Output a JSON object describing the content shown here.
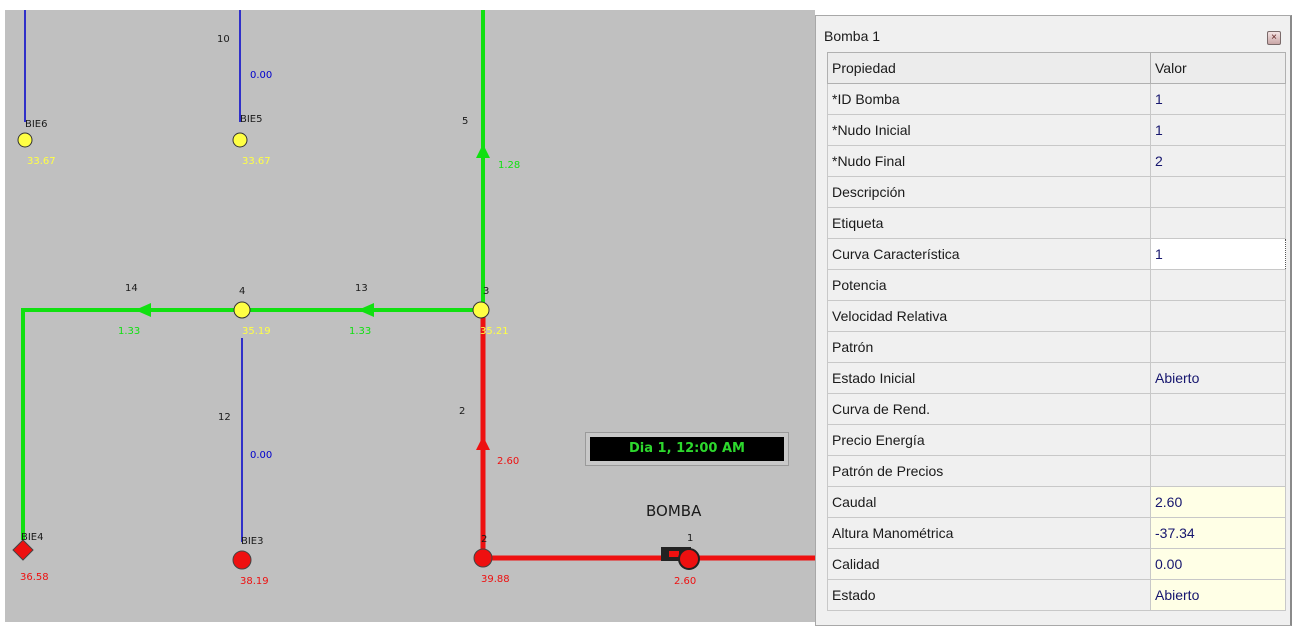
{
  "network": {
    "nodes": [
      {
        "id": "10",
        "value": ""
      },
      {
        "id": "BIE6",
        "value": "33.67"
      },
      {
        "id": "BIE5",
        "value": "33.67"
      },
      {
        "id": "4",
        "value": "35.19"
      },
      {
        "id": "3",
        "value": "35.21"
      },
      {
        "id": "BIE4",
        "value": "36.58"
      },
      {
        "id": "BIE3",
        "value": "38.19"
      },
      {
        "id": "2",
        "value": "39.88"
      }
    ],
    "links": [
      {
        "id": "5",
        "flow": "1.28"
      },
      {
        "id": "14",
        "flow": "1.33"
      },
      {
        "id": "13",
        "flow": "1.33"
      },
      {
        "id": "12",
        "flow": "0.00"
      },
      {
        "id": "2",
        "flow": "2.60"
      },
      {
        "id": "1",
        "flow": "2.60"
      }
    ],
    "link_10_flow": "0.00",
    "pump_label": "BOMBA",
    "colors": {
      "green": "#10e010",
      "red": "#ee1010",
      "blue": "#0000cc",
      "yellow": "#ffff44",
      "background": "#c0c0c0"
    }
  },
  "clock": "Dia 1, 12:00 AM",
  "panel": {
    "title": "Bomba 1",
    "close_icon": "close-icon",
    "columns": [
      "Propiedad",
      "Valor"
    ],
    "rows": [
      {
        "prop": "*ID Bomba",
        "value": "1"
      },
      {
        "prop": "*Nudo Inicial",
        "value": "1"
      },
      {
        "prop": "*Nudo Final",
        "value": "2"
      },
      {
        "prop": "Descripción",
        "value": ""
      },
      {
        "prop": "Etiqueta",
        "value": ""
      },
      {
        "prop": "Curva Característica",
        "value": "1"
      },
      {
        "prop": "Potencia",
        "value": ""
      },
      {
        "prop": "Velocidad Relativa",
        "value": ""
      },
      {
        "prop": "Patrón",
        "value": ""
      },
      {
        "prop": "Estado Inicial",
        "value": "Abierto"
      },
      {
        "prop": "Curva de Rend.",
        "value": ""
      },
      {
        "prop": "Precio Energía",
        "value": ""
      },
      {
        "prop": "Patrón de Precios",
        "value": ""
      },
      {
        "prop": "Caudal",
        "value": "2.60"
      },
      {
        "prop": "Altura Manométrica",
        "value": "-37.34"
      },
      {
        "prop": "Calidad",
        "value": "0.00"
      },
      {
        "prop": "Estado",
        "value": "Abierto"
      }
    ]
  }
}
